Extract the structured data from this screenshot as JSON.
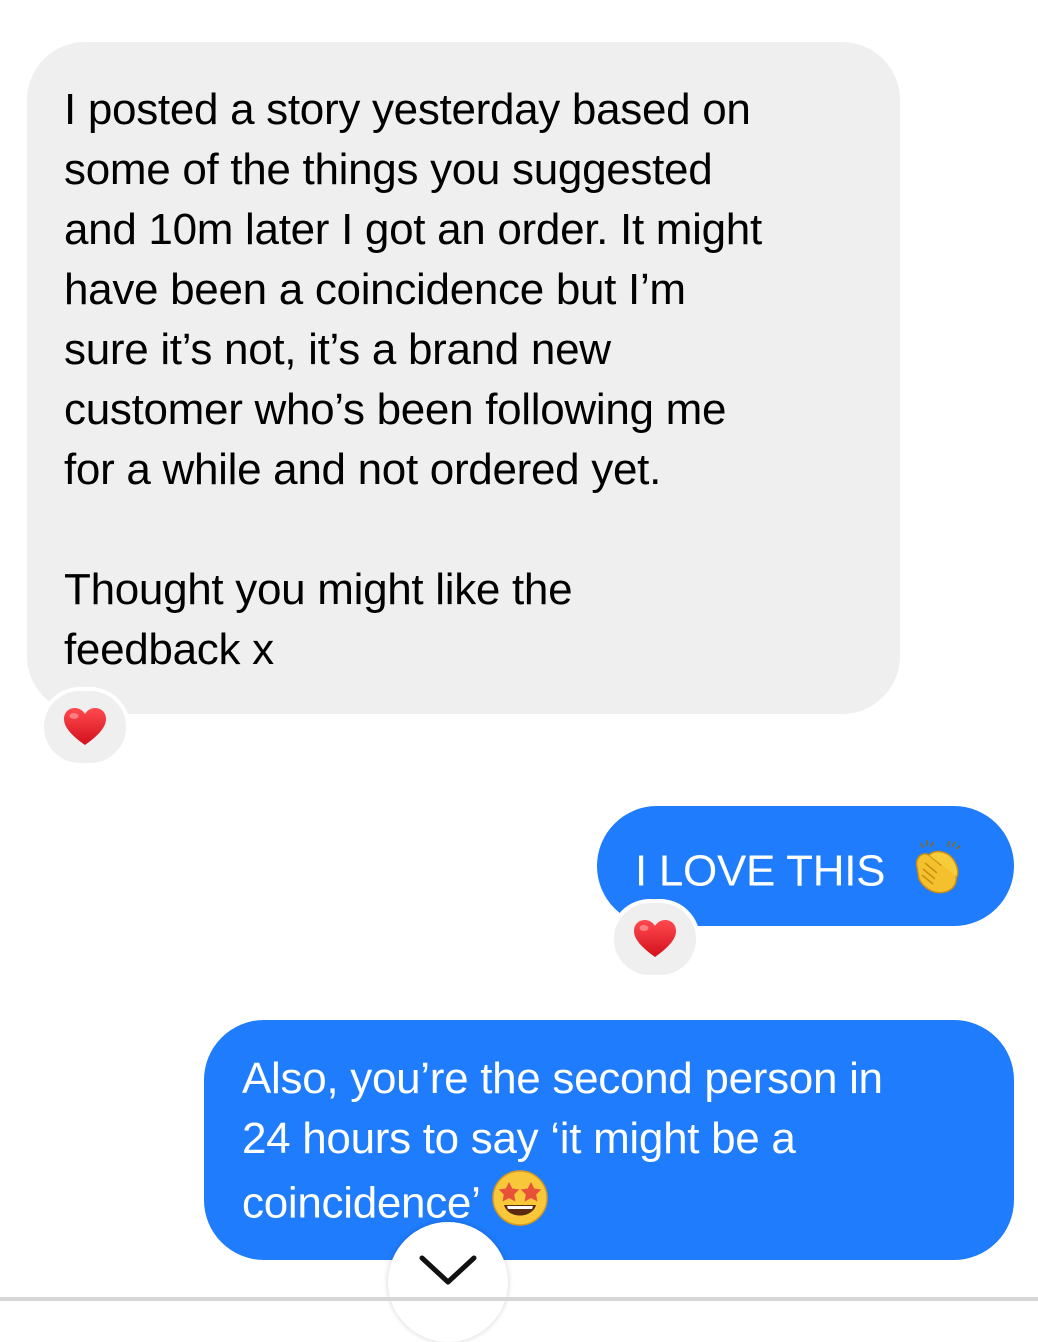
{
  "messages": [
    {
      "direction": "incoming",
      "paragraphs": [
        "I posted a story yesterday based on\nsome of the things you suggested\nand 10m later I got an order. It might\nhave been a coincidence but I’m\nsure it’s not, it’s a brand new\ncustomer who’s been following me\nfor a while and not ordered yet.",
        "Thought you might like the\nfeedback x"
      ],
      "reaction": "heart-icon"
    },
    {
      "direction": "outgoing",
      "text": "I LOVE THIS",
      "emoji": "clapping-hands-icon",
      "reaction": "heart-icon"
    },
    {
      "direction": "outgoing",
      "paragraphs": [
        "Also, you’re the second person in\n24 hours to say ‘it might be a\ncoincidence’"
      ],
      "emoji": "star-struck-face-icon"
    }
  ],
  "scroll_button": {
    "icon": "chevron-down-icon"
  },
  "colors": {
    "incoming_bubble": "#efefef",
    "outgoing_bubble": "#1f7cfd",
    "heart": "#e0202d"
  }
}
